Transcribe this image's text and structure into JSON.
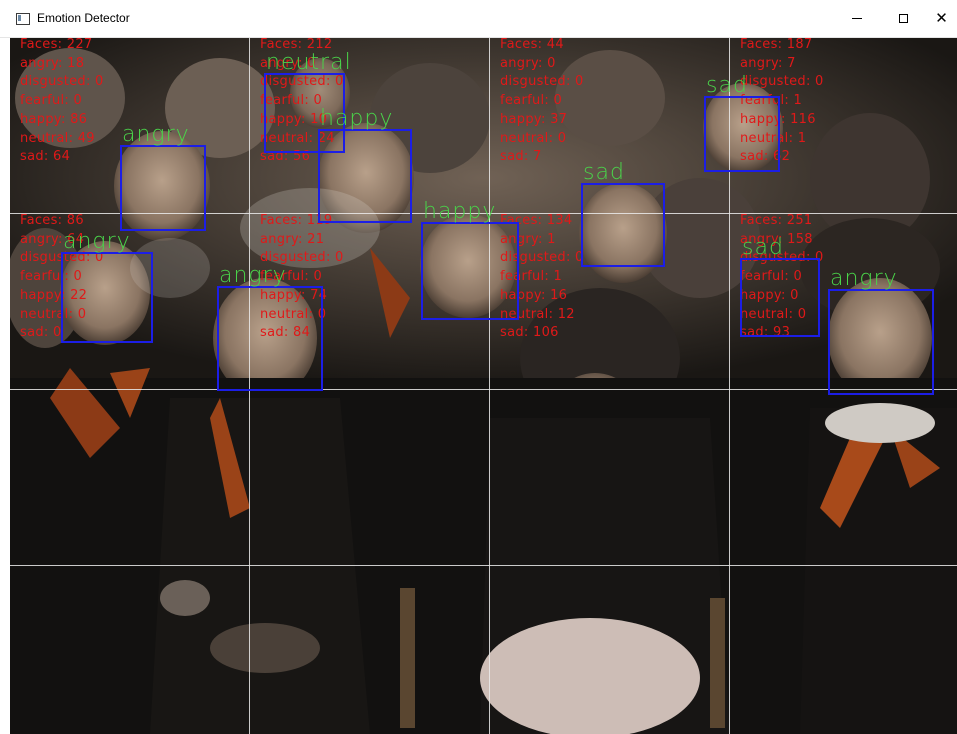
{
  "window": {
    "title": "Emotion Detector",
    "minimize_label": "—",
    "maximize_label": "☐",
    "close_label": "✕"
  },
  "colors": {
    "stats_text": "#e01919",
    "face_box": "#1c1ee6",
    "emotion_label": "#4ad44a",
    "grid": "#ebebeb"
  },
  "cells": [
    {
      "stats": [
        "Faces: 227",
        "angry: 18",
        "disgusted: 0",
        "fearful: 0",
        "happy: 86",
        "neutral: 49",
        "sad: 64"
      ]
    },
    {
      "stats": [
        "Faces: 212",
        "angry: 0",
        "disgusted: 0",
        "fearful: 0",
        "happy: 10",
        "neutral: 24",
        "sad: 56"
      ]
    },
    {
      "stats": [
        "Faces: 44",
        "angry: 0",
        "disgusted: 0",
        "fearful: 0",
        "happy: 37",
        "neutral: 0",
        "sad: 7"
      ]
    },
    {
      "stats": [
        "Faces: 187",
        "angry: 7",
        "disgusted: 0",
        "fearful: 1",
        "happy: 116",
        "neutral: 1",
        "sad: 62"
      ]
    },
    {
      "stats": [
        "Faces: 86",
        "angry: 64",
        "disgusted: 0",
        "fearful: 0",
        "happy: 22",
        "neutral: 0",
        "sad: 0"
      ]
    },
    {
      "stats": [
        "Faces: 119",
        "angry: 21",
        "disgusted: 0",
        "fearful: 0",
        "happy: 74",
        "neutral: 0",
        "sad: 84"
      ]
    },
    {
      "stats": [
        "Faces: 134",
        "angry: 1",
        "disgusted: 0",
        "fearful: 1",
        "happy: 16",
        "neutral: 12",
        "sad: 106"
      ]
    },
    {
      "stats": [
        "Faces: 251",
        "angry: 158",
        "disgusted: 0",
        "fearful: 0",
        "happy: 0",
        "neutral: 0",
        "sad: 93"
      ]
    }
  ],
  "faces": [
    {
      "emotion": "angry"
    },
    {
      "emotion": "neutral"
    },
    {
      "emotion": "happy"
    },
    {
      "emotion": "sad"
    },
    {
      "emotion": "sad"
    },
    {
      "emotion": "angry"
    },
    {
      "emotion": "angry"
    },
    {
      "emotion": "happy"
    },
    {
      "emotion": "sad"
    },
    {
      "emotion": "angry"
    }
  ]
}
